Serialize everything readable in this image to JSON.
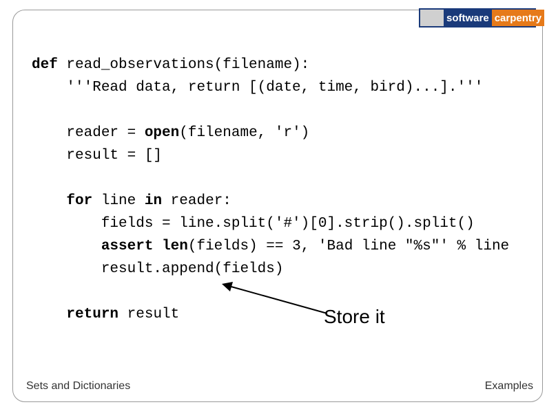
{
  "logo": {
    "software": "software",
    "carpentry": "carpentry"
  },
  "code": {
    "line1_def": "def",
    "line1_rest": " read_observations(filename):",
    "line2": "    '''Read data, return [(date, time, bird)...].'''",
    "line3": "",
    "line4_a": "    reader = ",
    "line4_open": "open",
    "line4_b": "(filename, 'r')",
    "line5": "    result = []",
    "line6": "",
    "line7_a": "    ",
    "line7_for": "for",
    "line7_b": " line ",
    "line7_in": "in",
    "line7_c": " reader:",
    "line8": "        fields = line.split('#')[0].strip().split()",
    "line9_a": "        ",
    "line9_assert": "assert",
    "line9_b": " ",
    "line9_len": "len",
    "line9_c": "(fields) == 3, 'Bad line \"%s\"' % line",
    "line10": "        result.append(fields)",
    "line11": "",
    "line12_a": "    ",
    "line12_return": "return",
    "line12_b": " result"
  },
  "annotation": "Store it",
  "footer": {
    "left": "Sets and Dictionaries",
    "right": "Examples"
  }
}
